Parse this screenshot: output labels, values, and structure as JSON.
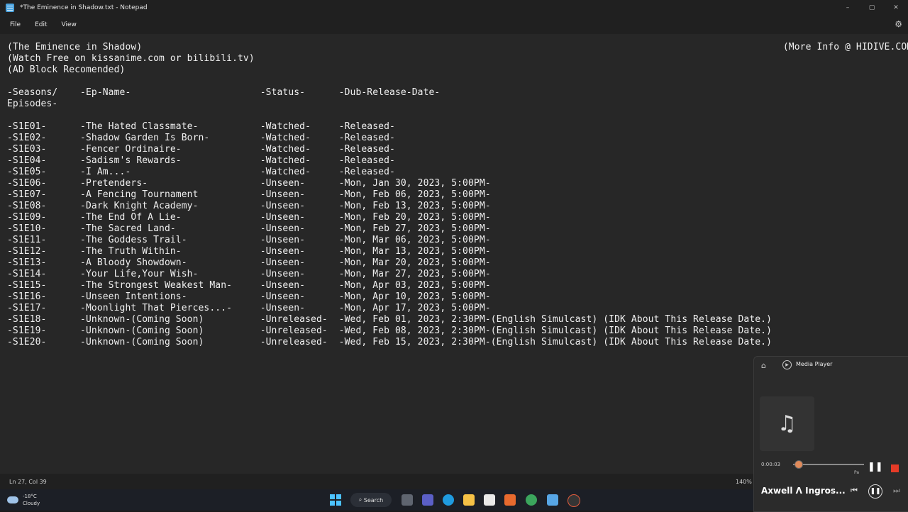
{
  "window": {
    "title": "*The Eminence in Shadow.txt - Notepad",
    "controls": {
      "minimize": "–",
      "maximize": "▢",
      "close": "✕"
    }
  },
  "menu": {
    "file": "File",
    "edit": "Edit",
    "view": "View"
  },
  "document": {
    "lines": [
      "(The Eminence in Shadow)                                                                                                                  (More Info @ HIDIVE.COM)",
      "(Watch Free on kissanime.com or bilibili.tv)",
      "(AD Block Recomended)",
      "",
      "-Seasons/    -Ep-Name-                       -Status-      -Dub-Release-Date-",
      "Episodes-",
      "",
      "-S1E01-      -The Hated Classmate-           -Watched-     -Released-",
      "-S1E02-      -Shadow Garden Is Born-         -Watched-     -Released-",
      "-S1E03-      -Fencer Ordinaire-              -Watched-     -Released-",
      "-S1E04-      -Sadism's Rewards-              -Watched-     -Released-",
      "-S1E05-      -I Am...-                       -Watched-     -Released-",
      "-S1E06-      -Pretenders-                    -Unseen-      -Mon, Jan 30, 2023, 5:00PM-",
      "-S1E07-      -A Fencing Tournament           -Unseen-      -Mon, Feb 06, 2023, 5:00PM-",
      "-S1E08-      -Dark Knight Academy-           -Unseen-      -Mon, Feb 13, 2023, 5:00PM-",
      "-S1E09-      -The End Of A Lie-              -Unseen-      -Mon, Feb 20, 2023, 5:00PM-",
      "-S1E10-      -The Sacred Land-               -Unseen-      -Mon, Feb 27, 2023, 5:00PM-",
      "-S1E11-      -The Goddess Trail-             -Unseen-      -Mon, Mar 06, 2023, 5:00PM-",
      "-S1E12-      -The Truth Within-              -Unseen-      -Mon, Mar 13, 2023, 5:00PM-",
      "-S1E13-      -A Bloody Showdown-             -Unseen-      -Mon, Mar 20, 2023, 5:00PM-",
      "-S1E14-      -Your Life,Your Wish-           -Unseen-      -Mon, Mar 27, 2023, 5:00PM-",
      "-S1E15-      -The Strongest Weakest Man-     -Unseen-      -Mon, Apr 03, 2023, 5:00PM-",
      "-S1E16-      -Unseen Intentions-             -Unseen-      -Mon, Apr 10, 2023, 5:00PM-",
      "-S1E17-      -Moonlight That Pierces...-     -Unseen-      -Mon, Apr 17, 2023, 5:00PM-",
      "-S1E18-      -Unknown-(Coming Soon)          -Unreleased-  -Wed, Feb 01, 2023, 2:30PM-(English Simulcast) (IDK About This Release Date.)",
      "-S1E19-      -Unknown-(Coming Soon)          -Unreleased-  -Wed, Feb 08, 2023, 2:30PM-(English Simulcast) (IDK About This Release Date.)",
      "-S1E20-      -Unknown-(Coming Soon)          -Unreleased-  -Wed, Feb 15, 2023, 2:30PM-(English Simulcast) (IDK About This Release Date.)"
    ]
  },
  "status": {
    "position": "Ln 27, Col 39",
    "zoom": "140%"
  },
  "taskbar": {
    "temperature": "-18°C",
    "weather": "Cloudy",
    "search": "Search"
  },
  "media_player": {
    "app_name": "Media Player",
    "elapsed": "0:00:03",
    "song": "Axwell Λ Ingros...",
    "tooltip": "Pa",
    "accent": "#e53b27"
  }
}
